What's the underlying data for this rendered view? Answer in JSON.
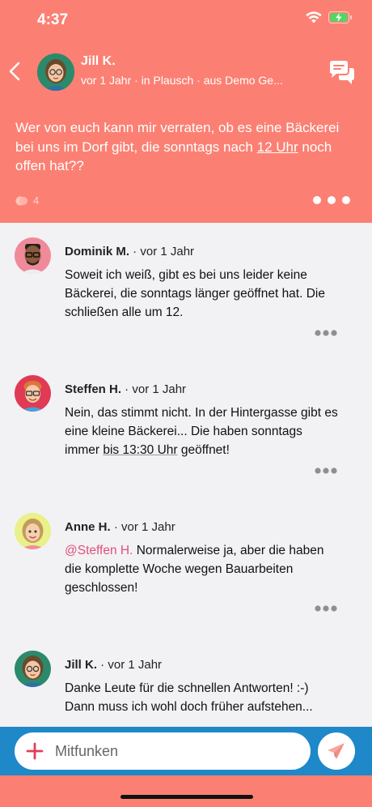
{
  "status_bar": {
    "time": "4:37",
    "icons": [
      "wifi-icon",
      "battery-charging-icon"
    ]
  },
  "header": {
    "author": "Jill K.",
    "meta": "vor 1 Jahr · in Plausch · aus Demo Ge...",
    "post": {
      "part1": "Wer von euch kann mir verraten, ob es eine Bäckerei bei uns im Dorf gibt, die sonntags nach ",
      "highlight": "12 Uhr",
      "part2": " noch offen hat??"
    },
    "reaction_count": "4"
  },
  "comments": [
    {
      "author": "Dominik M.",
      "time": "vor 1 Jahr",
      "text": "Soweit ich weiß, gibt es bei uns leider keine Bäckerei, die sonntags länger geöffnet hat. Die schließen alle um 12."
    },
    {
      "author": "Steffen H.",
      "time": "vor 1 Jahr",
      "text_part1": "Nein, das stimmt nicht. In der Hintergasse gibt es eine kleine Bäckerei... Die haben sonntags immer ",
      "text_highlight": "bis 13:30 Uhr",
      "text_part2": " geöffnet!"
    },
    {
      "author": "Anne H.",
      "time": "vor 1 Jahr",
      "mention": "@Steffen H.",
      "text": " Normalerweise ja, aber die haben die komplette Woche wegen Bauarbeiten geschlossen!"
    },
    {
      "author": "Jill K.",
      "time": "vor 1 Jahr",
      "text": "Danke Leute für die schnellen Antworten! :-) Dann muss ich wohl doch früher aufstehen..."
    }
  ],
  "input": {
    "placeholder": "Mitfunken"
  },
  "colors": {
    "header": "#fb8073",
    "input_bar": "#1e88c9",
    "mention": "#e0507a",
    "background": "#f2f2f5"
  }
}
